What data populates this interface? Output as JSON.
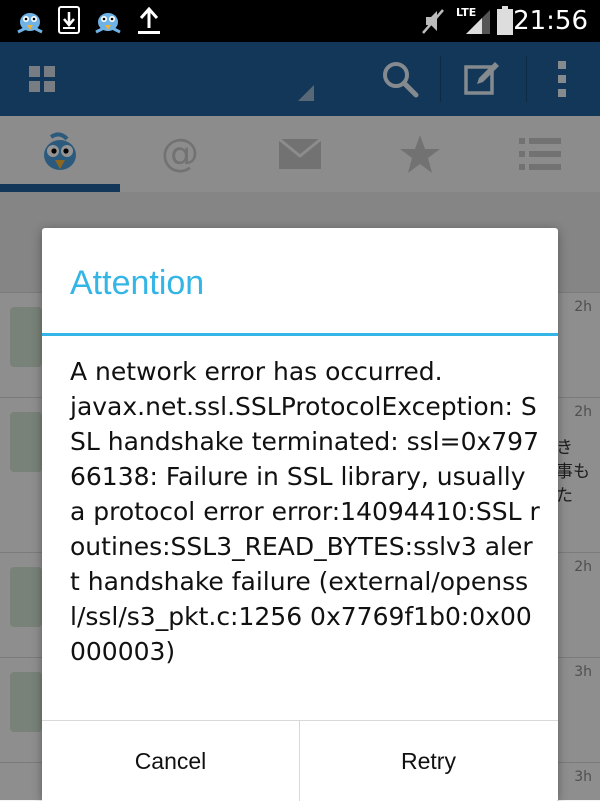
{
  "status_bar": {
    "time": "21:56",
    "icons": [
      "bird-notification-icon",
      "download-icon",
      "bird-notification-icon",
      "upload-icon",
      "mute-icon",
      "lte-signal-icon",
      "battery-icon"
    ],
    "network_label": "LTE"
  },
  "app_bar": {
    "icons": [
      "grid-menu-icon",
      "search-icon",
      "compose-icon",
      "overflow-menu-icon"
    ],
    "color": "#1f5f99"
  },
  "tabs": [
    {
      "icon": "bird-timeline-icon",
      "selected": true
    },
    {
      "icon": "at-mention-icon",
      "selected": false
    },
    {
      "icon": "mail-icon",
      "selected": false
    },
    {
      "icon": "star-icon",
      "selected": false
    },
    {
      "icon": "list-icon",
      "selected": false
    }
  ],
  "list": {
    "times": [
      "2h",
      "2h",
      "2h",
      "3h",
      "3h"
    ],
    "partial_text": "き\n事も\nた"
  },
  "dialog": {
    "title": "Attention",
    "message": "A network error has occurred.\njavax.net.ssl.SSLProtocolException: SSL handshake terminated: ssl=0x79766138: Failure in SSL library, usually a protocol error error:14094410:SSL routines:SSL3_READ_BYTES:sslv3 alert handshake failure (external/openssl/ssl/s3_pkt.c:1256 0x7769f1b0:0x00000003)",
    "cancel_label": "Cancel",
    "retry_label": "Retry",
    "accent_color": "#33b5e5"
  }
}
